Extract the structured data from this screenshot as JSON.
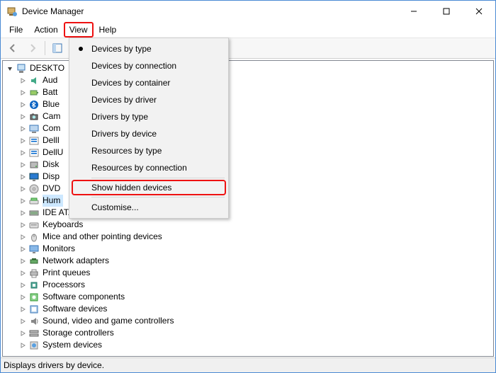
{
  "window": {
    "title": "Device Manager"
  },
  "menubar": {
    "file": "File",
    "action": "Action",
    "view": "View",
    "help": "Help"
  },
  "dropdown": {
    "items": [
      "Devices by type",
      "Devices by connection",
      "Devices by container",
      "Devices by driver",
      "Drivers by type",
      "Drivers by device",
      "Resources by type",
      "Resources by connection"
    ],
    "selected_index": 0,
    "show_hidden": "Show hidden devices",
    "customise": "Customise..."
  },
  "tree": {
    "root": "DESKTO",
    "items": [
      {
        "label": "Aud",
        "icon": "audio"
      },
      {
        "label": "Batt",
        "icon": "battery"
      },
      {
        "label": "Blue",
        "icon": "bluetooth"
      },
      {
        "label": "Cam",
        "icon": "camera"
      },
      {
        "label": "Com",
        "icon": "computer"
      },
      {
        "label": "DellI",
        "icon": "dell"
      },
      {
        "label": "DellU",
        "icon": "dell"
      },
      {
        "label": "Disk",
        "icon": "disk"
      },
      {
        "label": "Disp",
        "icon": "display"
      },
      {
        "label": "DVD",
        "icon": "dvd"
      },
      {
        "label": "Hum",
        "icon": "hid",
        "selected": true
      },
      {
        "label": "IDE ATA/ATAPI controllers",
        "icon": "ide"
      },
      {
        "label": "Keyboards",
        "icon": "keyboard"
      },
      {
        "label": "Mice and other pointing devices",
        "icon": "mouse"
      },
      {
        "label": "Monitors",
        "icon": "monitor"
      },
      {
        "label": "Network adapters",
        "icon": "network"
      },
      {
        "label": "Print queues",
        "icon": "printer"
      },
      {
        "label": "Processors",
        "icon": "cpu"
      },
      {
        "label": "Software components",
        "icon": "swc"
      },
      {
        "label": "Software devices",
        "icon": "swd"
      },
      {
        "label": "Sound, video and game controllers",
        "icon": "sound"
      },
      {
        "label": "Storage controllers",
        "icon": "storage"
      },
      {
        "label": "System devices",
        "icon": "system"
      }
    ]
  },
  "statusbar": "Displays drivers by device."
}
